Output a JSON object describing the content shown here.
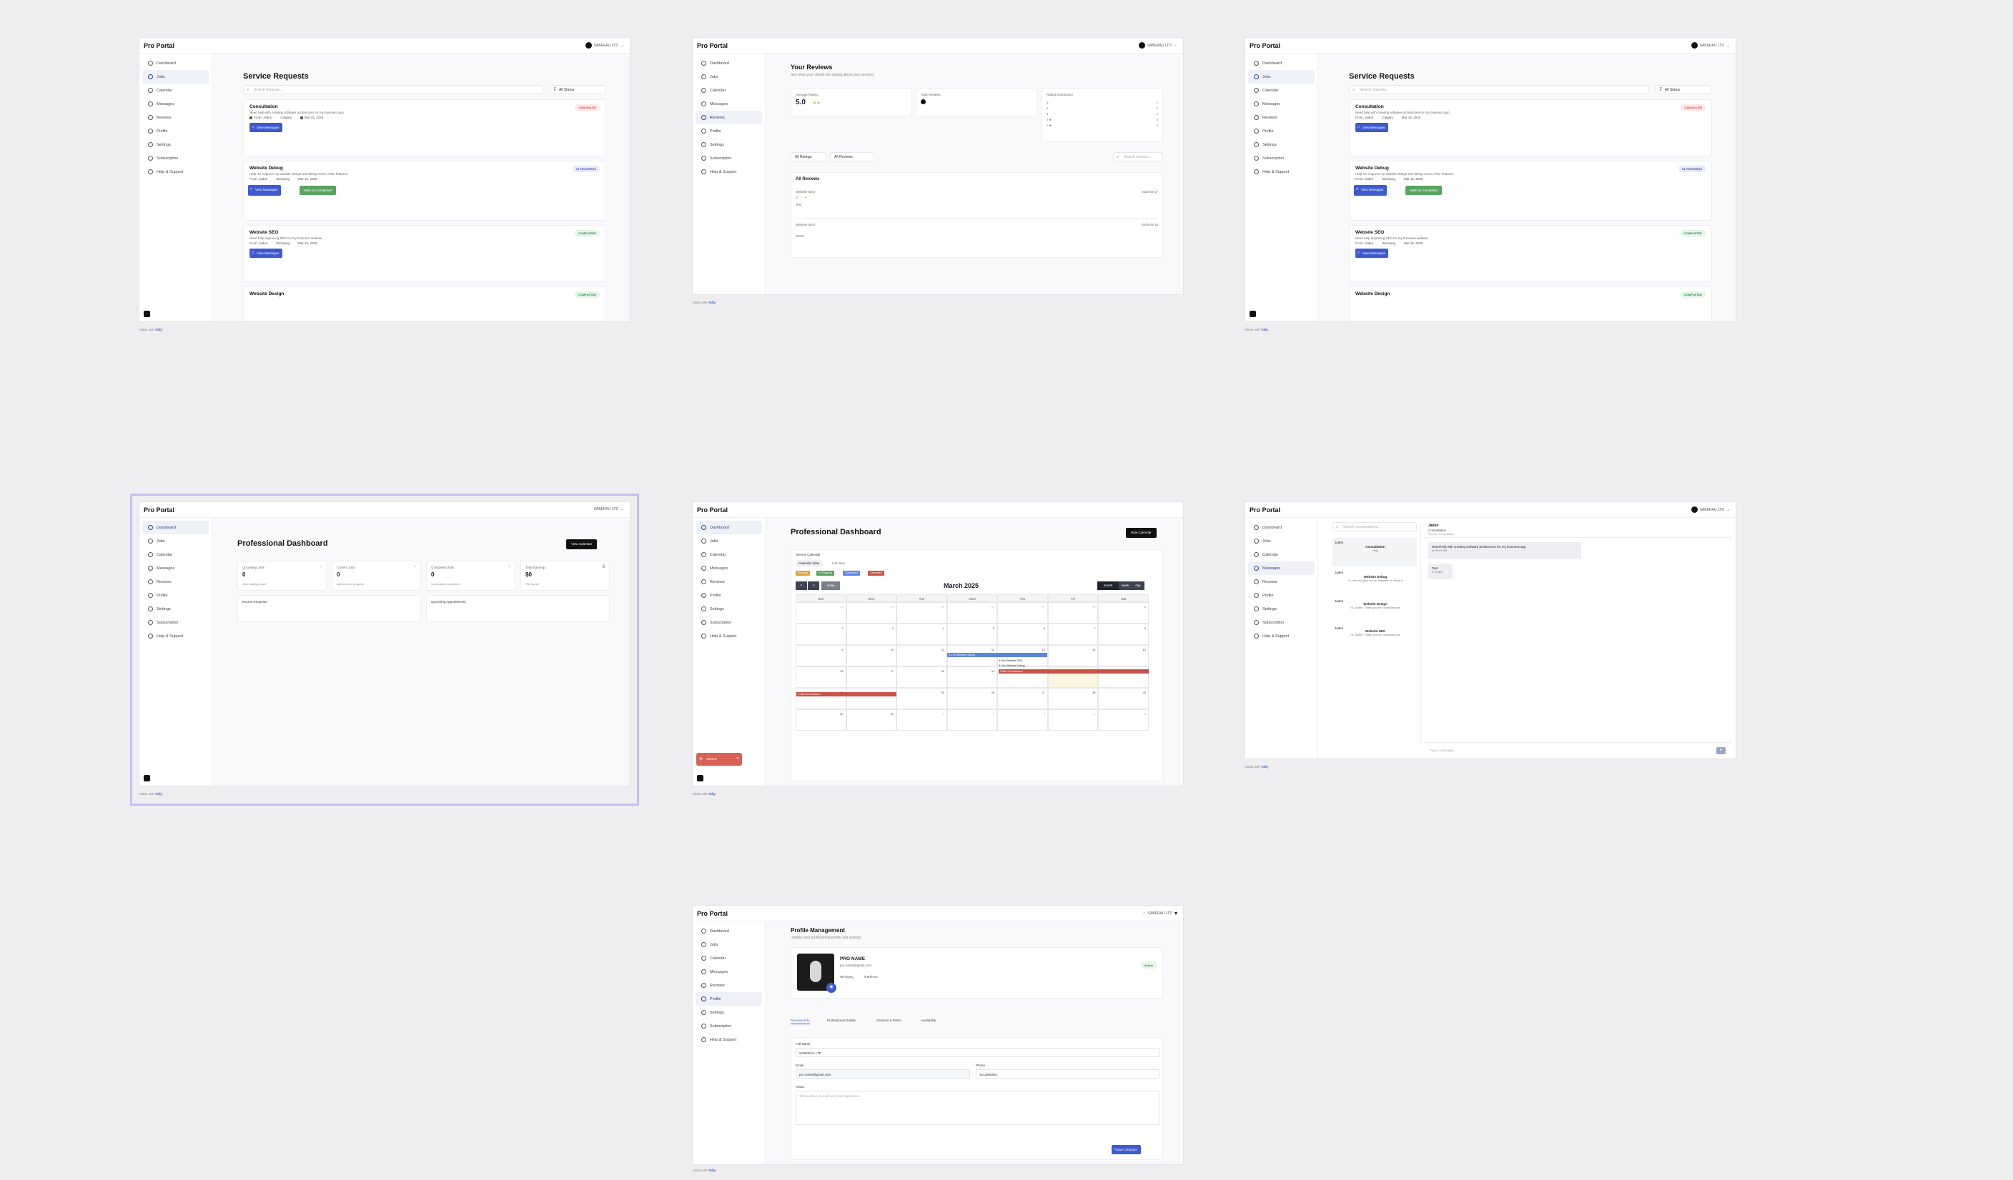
{
  "app": {
    "brand": "Pro Portal",
    "user": "SABERAU LTD",
    "made_by_prefix": "Made with",
    "made_by_brand": "Tolly"
  },
  "nav": [
    "Dashboard",
    "Jobs",
    "Calendar",
    "Messages",
    "Reviews",
    "Profile",
    "Settings",
    "Subscription",
    "Help & Support"
  ],
  "requests": {
    "title": "Service Requests",
    "search_placeholder": "Search requests...",
    "filter": "All Status",
    "view_messages": "View Messages",
    "mark_completed": "Mark as Completed",
    "items": [
      {
        "title": "Consultation",
        "desc": "Need help with creating software architecture for my business app",
        "from": "From: Jaden",
        "place": "Calgary",
        "date": "Mar 15, 2025",
        "status": "CANCELLED"
      },
      {
        "title": "Website Debug",
        "desc": "Help me improve my website design and debug some of the features",
        "from": "From: Jaden",
        "place": "Winnipeg",
        "date": "Mar 15, 2025",
        "status": "IN PROGRESS"
      },
      {
        "title": "Website SEO",
        "desc": "Need help improving SEO for my business website",
        "from": "From: Jaden",
        "place": "Winnipeg",
        "date": "Mar 15, 2025",
        "status": "COMPLETED"
      },
      {
        "title": "Website Design",
        "status": "COMPLETED"
      }
    ]
  },
  "reviews": {
    "title": "Your Reviews",
    "subtitle": "See what your clients are saying about your services",
    "avg_label": "Average Rating",
    "avg_value": "5.0",
    "total_label": "Total Reviews",
    "dist_label": "Rating Distribution",
    "dist_stars": [
      "5",
      "4",
      "3",
      "2 ★",
      "1 ★"
    ],
    "dist_counts": [
      "2",
      "0",
      "0",
      "0",
      "0"
    ],
    "filter_ratings": "All Ratings",
    "filter_reviews": "All Reviews",
    "search_placeholder": "Search reviews...",
    "list_title": "All Reviews",
    "items": [
      {
        "service": "Website SEO",
        "date": "2025-03-17",
        "text": "Test"
      },
      {
        "service": "Website SEO",
        "date": "2025-03-15",
        "text": "Great"
      }
    ]
  },
  "dashboard": {
    "title": "Professional Dashboard",
    "view_calendar": "View Calendar",
    "hide_calendar": "Hide Calendar",
    "stats": [
      {
        "label": "Upcoming Jobs",
        "value": "0",
        "note": "Jobs waiting to start"
      },
      {
        "label": "Current Jobs",
        "value": "0",
        "note": "Active jobs in progress"
      },
      {
        "label": "Completed Jobs",
        "value": "0",
        "note": "Successfully completed"
      },
      {
        "label": "Total Earnings",
        "value": "$0",
        "note": "This month"
      }
    ],
    "recent_requests": "Recent Requests",
    "upcoming_appointments": "Upcoming Appointments"
  },
  "calendar": {
    "section": "Service Calendar",
    "view_calendar": "Calendar View",
    "view_list": "List View",
    "legend": [
      {
        "label": "Pending",
        "color": "#e0a33c"
      },
      {
        "label": "In Progress",
        "color": "#58a35f"
      },
      {
        "label": "Completed",
        "color": "#5b86df"
      },
      {
        "label": "Cancelled",
        "color": "#c9534a"
      }
    ],
    "prev": "<",
    "next": ">",
    "today": "today",
    "month_title": "March 2025",
    "view_month": "month",
    "view_week": "week",
    "view_day": "day",
    "days": [
      "Sun",
      "Mon",
      "Tue",
      "Wed",
      "Thu",
      "Fri",
      "Sat"
    ],
    "dates": [
      "23",
      "24",
      "25",
      "26",
      "27",
      "28",
      "1",
      "2",
      "3",
      "4",
      "5",
      "6",
      "7",
      "8",
      "9",
      "10",
      "11",
      "12",
      "13",
      "14",
      "15",
      "16",
      "17",
      "18",
      "19",
      "20",
      "21",
      "22",
      "23",
      "24",
      "25",
      "26",
      "27",
      "28",
      "29",
      "30",
      "31",
      "1",
      "2",
      "3",
      "4",
      "5"
    ],
    "events": {
      "debug": "9:17a Website Debug",
      "seo1": "9:16a Website SEO",
      "seo2": "9:16a Website Debug",
      "consult": "9:55a Consultation",
      "consult2": "9:15a Consultation"
    },
    "toast": "Service"
  },
  "messages": {
    "search_placeholder": "Search conversations...",
    "threads": [
      {
        "name": "Jaden",
        "service": "Consultation",
        "snippet": "Hey!"
      },
      {
        "name": "Jaden",
        "service": "Website Debug",
        "snippet": "Hi, can you give me an estimate for fixing it"
      },
      {
        "name": "Jaden",
        "service": "Website Design",
        "snippet": "Hi, Jaden. Thank you for contacting me"
      },
      {
        "name": "Jaden",
        "service": "Website SEO",
        "snippet": "Hi, Jaden. Thank you for contacting me"
      }
    ],
    "header_name": "Jaden",
    "header_service": "Consultation",
    "header_sub": "Service: Consultation",
    "bubble1": "Need help with creating software architecture for my business app",
    "bubble1_time": "at 09:47 AM",
    "bubble2": "Test",
    "bubble2_time": "9:44 AM",
    "input_placeholder": "Type a message...",
    "send": "➤"
  },
  "profile": {
    "title": "Profile Management",
    "subtitle": "Update your professional profile and settings",
    "name": "PRO NAME",
    "email_line": "pro.name@gmail.com",
    "location": "Winnipeg",
    "rate": "$ 80/hour",
    "status": "Active",
    "tabs": [
      "Personal Info",
      "Professional Details",
      "Services & Rates",
      "Availability"
    ],
    "full_name_label": "Full Name",
    "full_name": "SABERAU LTD",
    "email_label": "Email",
    "email": "pro.name@gmail.com",
    "phone_label": "Phone",
    "phone": "4312966834",
    "about_label": "About",
    "about_placeholder": "Tell us about yourself and your experience...",
    "save": "Save Changes"
  }
}
